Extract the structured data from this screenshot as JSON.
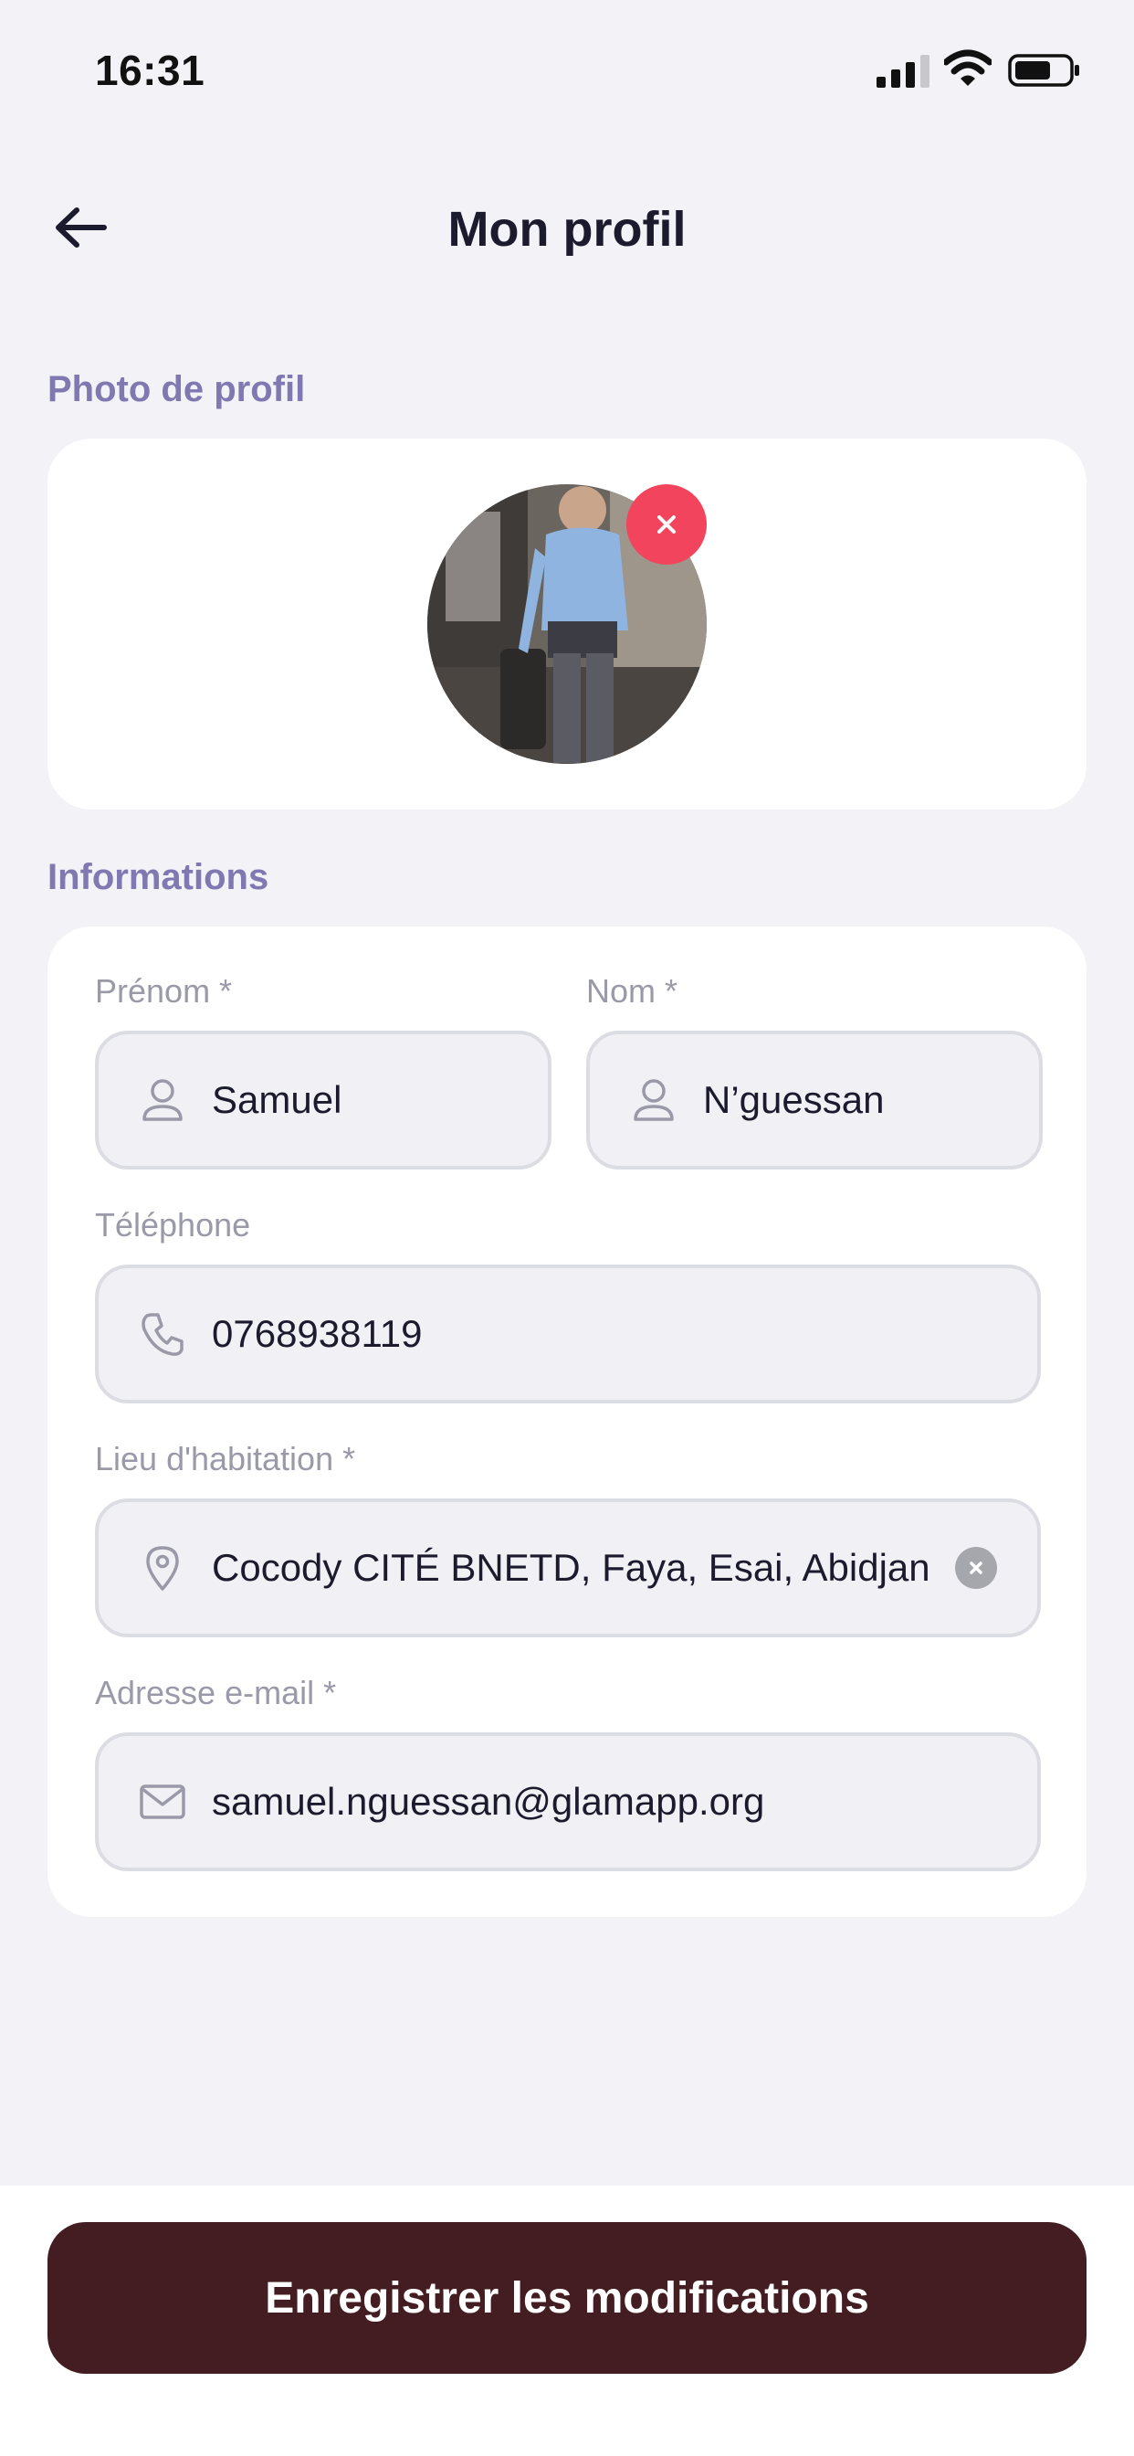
{
  "status_bar": {
    "time": "16:31"
  },
  "header": {
    "title": "Mon profil",
    "back_icon": "arrow-left-icon"
  },
  "photo_section": {
    "label": "Photo de profil",
    "remove_icon": "close-icon",
    "remove_color": "#f2455d"
  },
  "info_section": {
    "label": "Informations",
    "fields": {
      "first_name": {
        "label": "Prénom *",
        "value": "Samuel",
        "icon": "user-icon"
      },
      "last_name": {
        "label": "Nom *",
        "value": "N’guessan",
        "icon": "user-icon"
      },
      "phone": {
        "label": "Téléphone",
        "value": "0768938119",
        "icon": "phone-icon"
      },
      "location": {
        "label": "Lieu d'habitation *",
        "value": "Cocody CITÉ BNETD, Faya, Esai, Abidjan",
        "icon": "location-pin-icon",
        "clear_icon": "clear-icon"
      },
      "email": {
        "label": "Adresse e-mail *",
        "value": "samuel.nguessan@glamapp.org",
        "icon": "mail-icon"
      }
    }
  },
  "footer": {
    "save_label": "Enregistrer les modifications",
    "save_color": "#431d21"
  },
  "colors": {
    "background": "#f2f2f7",
    "card": "#ffffff",
    "section_label": "#8078b0",
    "field_bg": "#f1f1f5"
  }
}
